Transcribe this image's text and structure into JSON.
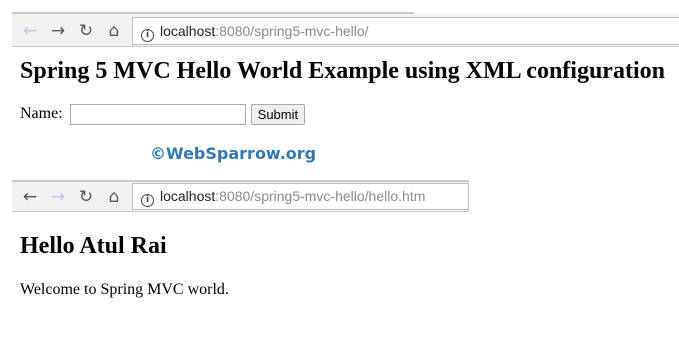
{
  "browser1": {
    "url_host": "localhost",
    "url_path": ":8080/spring5-mvc-hello/",
    "back_icon": "arrow-left",
    "forward_icon": "arrow-right",
    "reload_icon": "reload",
    "home_icon": "home"
  },
  "page1": {
    "title": "Spring 5 MVC Hello World Example using XML configuration",
    "name_label": "Name:",
    "name_value": "",
    "submit_label": "Submit"
  },
  "watermark": "©WebSparrow.org",
  "browser2": {
    "url_host": "localhost",
    "url_path": ":8080/spring5-mvc-hello/hello.htm"
  },
  "page2": {
    "heading": "Hello Atul Rai",
    "message": "Welcome to Spring MVC world."
  },
  "colors": {
    "disabled_nav": "#b3c9e6",
    "watermark": "#2e7ab8"
  }
}
